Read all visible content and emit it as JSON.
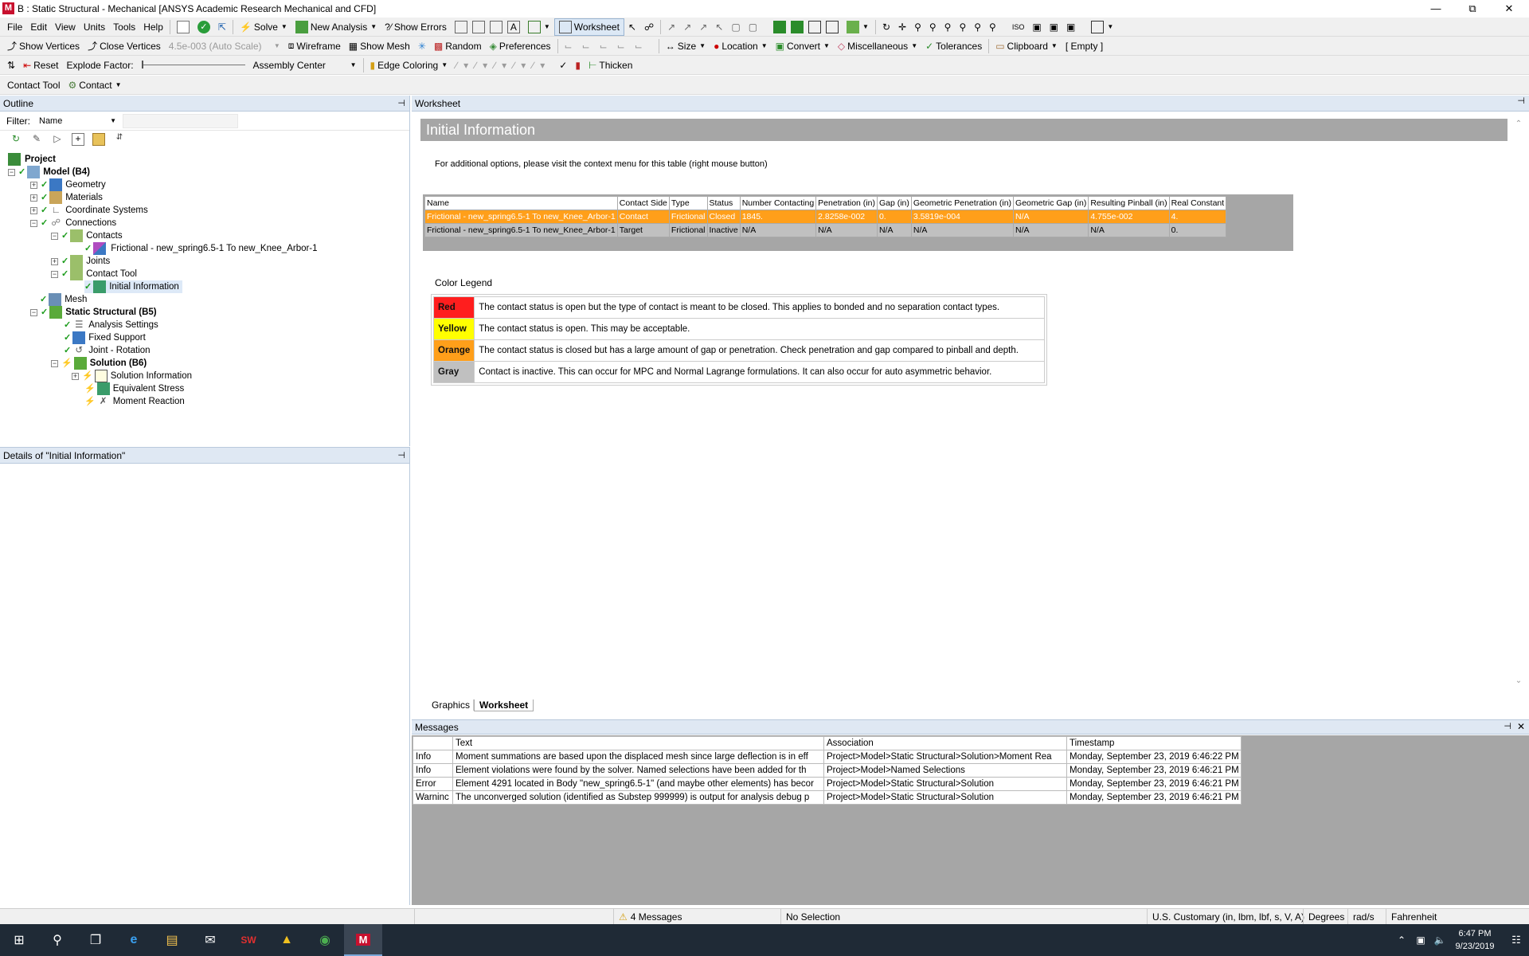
{
  "window": {
    "title": "B : Static Structural - Mechanical [ANSYS Academic Research Mechanical and CFD]",
    "app_icon_letter": "M",
    "brand_color": "#c8102e"
  },
  "menu": [
    "File",
    "Edit",
    "View",
    "Units",
    "Tools",
    "Help"
  ],
  "toolbar1": {
    "solve": "Solve",
    "new_analysis": "New Analysis",
    "show_errors": "Show Errors",
    "worksheet": "Worksheet"
  },
  "toolbar2": {
    "show_vertices": "Show Vertices",
    "close_vertices": "Close Vertices",
    "scale": "4.5e-003 (Auto Scale)",
    "wireframe": "Wireframe",
    "show_mesh": "Show Mesh",
    "random": "Random",
    "preferences": "Preferences",
    "size": "Size",
    "location": "Location",
    "convert": "Convert",
    "miscellaneous": "Miscellaneous",
    "tolerances": "Tolerances",
    "clipboard": "Clipboard",
    "clipboard_state": "[ Empty ]"
  },
  "toolbar3": {
    "reset": "Reset",
    "explode_factor": "Explode Factor:",
    "assembly_center": "Assembly Center",
    "edge_coloring": "Edge Coloring",
    "thicken": "Thicken"
  },
  "context_toolbar": {
    "label": "Contact Tool",
    "contact": "Contact"
  },
  "outline": {
    "header": "Outline",
    "filter_label": "Filter:",
    "filter_value": "Name",
    "tree": {
      "project": "Project",
      "model": "Model (B4)",
      "geometry": "Geometry",
      "materials": "Materials",
      "coordinate_systems": "Coordinate Systems",
      "connections": "Connections",
      "contacts": "Contacts",
      "frictional": "Frictional - new_spring6.5-1 To new_Knee_Arbor-1",
      "joints": "Joints",
      "contact_tool": "Contact Tool",
      "initial_information": "Initial Information",
      "mesh": "Mesh",
      "static_structural": "Static Structural (B5)",
      "analysis_settings": "Analysis Settings",
      "fixed_support": "Fixed Support",
      "joint_rotation": "Joint - Rotation",
      "solution": "Solution (B6)",
      "solution_information": "Solution Information",
      "equivalent_stress": "Equivalent Stress",
      "moment_reaction": "Moment Reaction"
    }
  },
  "details": {
    "header": "Details of \"Initial Information\""
  },
  "worksheet": {
    "header": "Worksheet",
    "banner": "Initial Information",
    "note": "For additional options, please visit the context menu for this table (right mouse button)",
    "table": {
      "headers": [
        "Name",
        "Contact Side",
        "Type",
        "Status",
        "Number Contacting",
        "Penetration (in)",
        "Gap (in)",
        "Geometric Penetration (in)",
        "Geometric Gap (in)",
        "Resulting Pinball (in)",
        "Real Constant"
      ],
      "rows": [
        [
          "Frictional - new_spring6.5-1 To new_Knee_Arbor-1",
          "Contact",
          "Frictional",
          "Closed",
          "1845.",
          "2.8258e-002",
          "0.",
          "3.5819e-004",
          "N/A",
          "4.755e-002",
          "4."
        ],
        [
          "Frictional - new_spring6.5-1 To new_Knee_Arbor-1",
          "Target",
          "Frictional",
          "Inactive",
          "N/A",
          "N/A",
          "N/A",
          "N/A",
          "N/A",
          "N/A",
          "0."
        ]
      ],
      "row_colors": [
        "#ff9f1a",
        "#c0c0c0"
      ]
    },
    "legend_title": "Color Legend",
    "legend": [
      {
        "name": "Red",
        "color": "#ff1e1e",
        "text": "The contact status is open but the type of contact is meant to be closed. This applies to bonded and no separation contact types."
      },
      {
        "name": "Yellow",
        "color": "#ffff00",
        "text": "The contact status is open. This may be acceptable."
      },
      {
        "name": "Orange",
        "color": "#ff9f1a",
        "text": "The contact status is closed but has a large amount of gap or penetration. Check penetration and gap compared to pinball and depth."
      },
      {
        "name": "Gray",
        "color": "#c0c0c0",
        "text": "Contact is inactive. This can occur for MPC and Normal Lagrange formulations. It can also occur for auto asymmetric behavior."
      }
    ],
    "tabs": [
      "Graphics",
      "Worksheet"
    ]
  },
  "messages": {
    "header": "Messages",
    "headers": [
      "",
      "Text",
      "Association",
      "Timestamp"
    ],
    "rows": [
      [
        "Info",
        "Moment summations are based upon the displaced mesh since large deflection is in eff",
        "Project>Model>Static Structural>Solution>Moment Rea",
        "Monday, September 23, 2019 6:46:22 PM"
      ],
      [
        "Info",
        "Element violations were found by the solver.  Named selections have been added for th",
        "Project>Model>Named Selections",
        "Monday, September 23, 2019 6:46:21 PM"
      ],
      [
        "Error",
        "Element 4291 located in Body \"new_spring6.5-1\" (and maybe other elements) has becor",
        "Project>Model>Static Structural>Solution",
        "Monday, September 23, 2019 6:46:21 PM"
      ],
      [
        "Warninc",
        "The unconverged solution (identified as Substep 999999) is output for analysis debug p",
        "Project>Model>Static Structural>Solution",
        "Monday, September 23, 2019 6:46:21 PM"
      ]
    ]
  },
  "statusbar": {
    "messages": "4 Messages",
    "selection": "No Selection",
    "units": "U.S. Customary (in, lbm, lbf, s, V, A)",
    "angle": "Degrees",
    "rate": "rad/s",
    "temp": "Fahrenheit"
  },
  "taskbar": {
    "time": "6:47 PM",
    "date": "9/23/2019"
  }
}
